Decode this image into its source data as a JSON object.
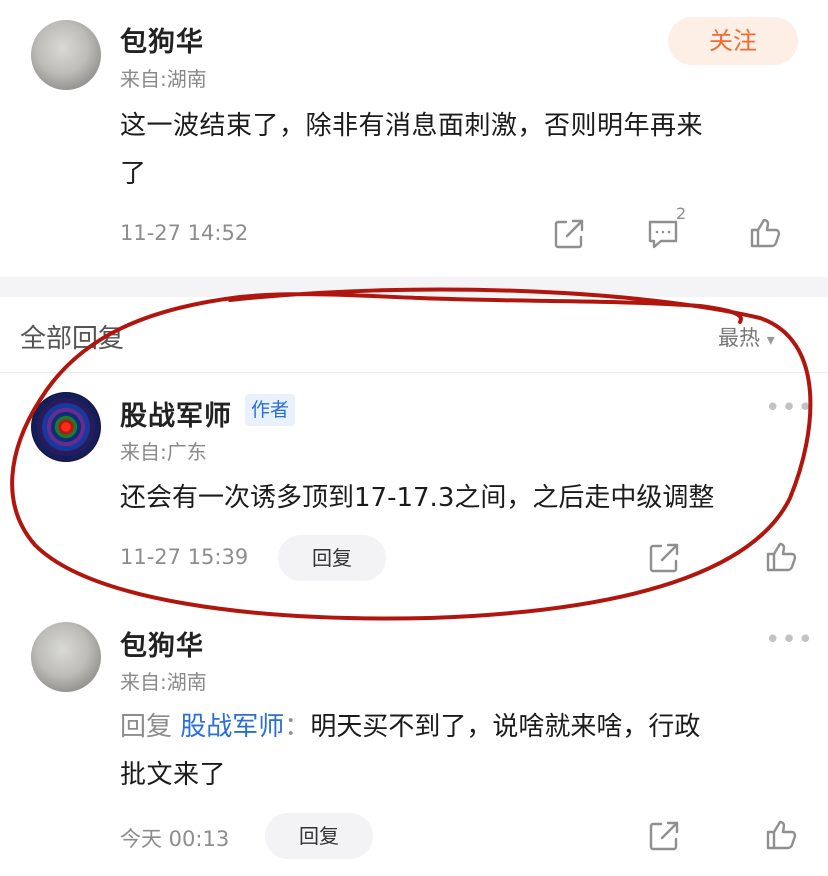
{
  "top_comment": {
    "username": "包狗华",
    "from": "来自:湖南",
    "follow_label": "关注",
    "text_line1": "这一波结束了，除非有消息面刺激，否则明年再来",
    "text_line2": "了",
    "timestamp": "11-27 14:52",
    "comment_count": "2"
  },
  "replies_section": {
    "title": "全部回复",
    "sort_label": "最热",
    "sort_arrow": "▾"
  },
  "reply1": {
    "username": "股战军师",
    "author_tag": "作者",
    "from": "来自:广东",
    "text": "还会有一次诱多顶到17-17.3之间，之后走中级调整",
    "timestamp": "11-27 15:39",
    "reply_label": "回复"
  },
  "reply2": {
    "username": "包狗华",
    "from": "来自:湖南",
    "reply_prefix": "回复",
    "reply_to": "股战军师",
    "colon": "：",
    "text_line1": "明天买不到了，说啥就来啥，行政",
    "text_line2": "批文来了",
    "timestamp": "今天 00:13",
    "reply_label": "回复"
  },
  "colors": {
    "follow_text": "#f26a35",
    "author_tag": "#2a6fd8",
    "annotation_circle": "#b0160e"
  },
  "icons": [
    "share-icon",
    "comment-icon",
    "like-icon",
    "more-icon",
    "chevron-down-icon"
  ]
}
